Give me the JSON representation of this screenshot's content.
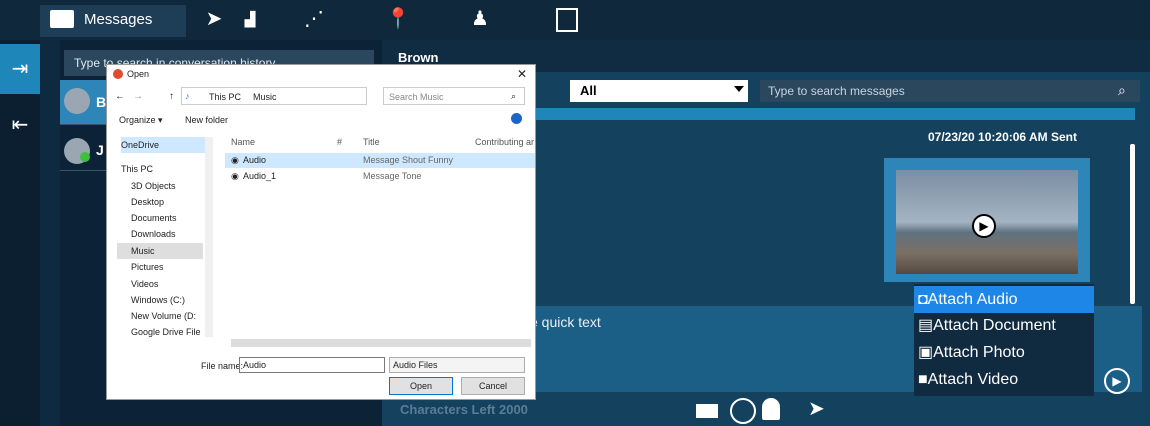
{
  "topbar": {
    "tabs": [
      {
        "label": "Messages",
        "icon": "messages-icon"
      },
      {
        "label": "",
        "icon": "send-icon"
      },
      {
        "label": "",
        "icon": "route-icon"
      },
      {
        "label": "",
        "icon": "location-icon"
      },
      {
        "label": "",
        "icon": "group-icon"
      },
      {
        "label": "",
        "icon": "video-wall-icon"
      }
    ]
  },
  "left_rail": {
    "items": [
      {
        "icon": "login-icon"
      },
      {
        "icon": "logout-icon"
      }
    ]
  },
  "conversations": {
    "search_placeholder": "Type to search in conversation history",
    "rows": [
      {
        "name": "B",
        "status": "offline"
      },
      {
        "name": "J",
        "status": "online"
      }
    ]
  },
  "conversation": {
    "name": "Brown",
    "filter_value": "All",
    "search_placeholder": "Type to search messages",
    "message_timestamp": "07/23/20 10:20:06 AM Sent",
    "compose_placeholder_fragment": "e quick text",
    "characters_left": "Characters Left 2000"
  },
  "attach_menu": {
    "items": [
      "Attach Audio",
      "Attach Document",
      "Attach Photo",
      "Attach Video"
    ]
  },
  "open_dialog": {
    "title": "Open",
    "close": "✕",
    "path": [
      "This PC",
      "Music"
    ],
    "search_placeholder": "Search Music",
    "organize": "Organize ▾",
    "new_folder": "New folder",
    "columns": [
      "Name",
      "#",
      "Title",
      "Contributing ar"
    ],
    "files": [
      {
        "name": "Audio",
        "title": "Message Shout Funny"
      },
      {
        "name": "Audio_1",
        "title": "Message Tone"
      }
    ],
    "nav": [
      "OneDrive",
      "This PC",
      "3D Objects",
      "Desktop",
      "Documents",
      "Downloads",
      "Music",
      "Pictures",
      "Videos",
      "Windows (C:)",
      "New Volume (D:",
      "Google Drive File"
    ],
    "file_name_label": "File name:",
    "file_name_value": "Audio",
    "file_type": "Audio Files",
    "open_button": "Open",
    "cancel_button": "Cancel"
  }
}
